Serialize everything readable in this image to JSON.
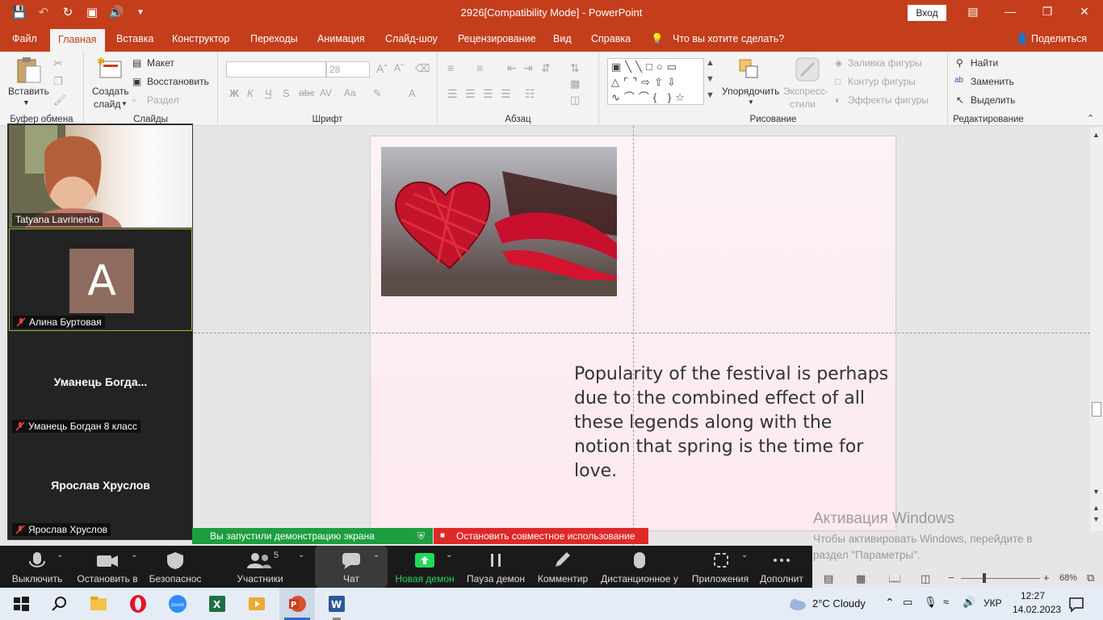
{
  "window": {
    "title": "2926[Compatibility Mode]  -  PowerPoint",
    "signin_label": "Вход"
  },
  "tabs": [
    {
      "label": "Файл",
      "active": false
    },
    {
      "label": "Главная",
      "active": true
    },
    {
      "label": "Вставка",
      "active": false
    },
    {
      "label": "Конструктор",
      "active": false
    },
    {
      "label": "Переходы",
      "active": false
    },
    {
      "label": "Анимация",
      "active": false
    },
    {
      "label": "Слайд-шоу",
      "active": false
    },
    {
      "label": "Рецензирование",
      "active": false
    },
    {
      "label": "Вид",
      "active": false
    },
    {
      "label": "Справка",
      "active": false
    }
  ],
  "tell_me": "Что вы хотите сделать?",
  "share_label": "Поделиться",
  "ribbon": {
    "clipboard": {
      "group": "Буфер обмена",
      "paste": "Вставить"
    },
    "slides": {
      "group": "Слайды",
      "new_slide_1": "Создать",
      "new_slide_2": "слайд",
      "layout": "Макет",
      "reset": "Восстановить",
      "section": "Раздел"
    },
    "font": {
      "group": "Шрифт",
      "size": "28"
    },
    "paragraph": {
      "group": "Абзац"
    },
    "drawing": {
      "group": "Рисование",
      "arrange": "Упорядочить",
      "quick_styles_1": "Экспресс-",
      "quick_styles_2": "стили",
      "fill": "Заливка фигуры",
      "outline": "Контур фигуры",
      "effects": "Эффекты фигуры"
    },
    "editing": {
      "group": "Редактирование",
      "find": "Найти",
      "replace": "Заменить",
      "select": "Выделить"
    }
  },
  "slide": {
    "body_text": "Popularity of the festival is perhaps due to the combined effect of all these legends along with the notion that spring is the time for love."
  },
  "activation": {
    "title": "Активация Windows",
    "line1": "Чтобы активировать Windows, перейдите в",
    "line2": "раздел \"Параметры\"."
  },
  "participants": [
    {
      "tile_name": "",
      "label": "Tatyana Lavrinenko",
      "muted": false,
      "video": true
    },
    {
      "tile_name": "A",
      "label": "Алина Буртовая",
      "muted": true,
      "video": false
    },
    {
      "tile_name": "Уманець  Богда...",
      "label": "Уманець Богдан 8 класс",
      "muted": true,
      "video": false
    },
    {
      "tile_name": "Ярослав Хруслов",
      "label": "Ярослав Хруслов",
      "muted": true,
      "video": false
    }
  ],
  "share_banner": {
    "started": "Вы запустили демонстрацию экрана",
    "stop": "Остановить совместное использование"
  },
  "zoom_toolbar": {
    "mute": "Выключить",
    "video": "Остановить в",
    "security": "Безопаснос",
    "participants": "Участники",
    "participants_count": "5",
    "chat": "Чат",
    "new_share": "Новая демон",
    "pause_share": "Пауза демон",
    "annotate": "Комментир",
    "remote_control": "Дистанционное у",
    "apps": "Приложения",
    "more": "Дополнит"
  },
  "statusbar": {
    "zoom": "68%"
  },
  "taskbar": {
    "weather": "2°C  Cloudy",
    "lang": "УКР",
    "time": "12:27",
    "date": "14.02.2023"
  },
  "colors": {
    "accent": "#c43e1c",
    "share_green": "#1d9e3f",
    "share_red": "#e02828"
  }
}
